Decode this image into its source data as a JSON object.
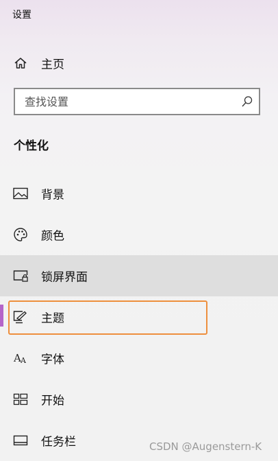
{
  "window": {
    "title": "设置"
  },
  "home": {
    "label": "主页",
    "icon": "home-icon"
  },
  "search": {
    "placeholder": "查找设置",
    "icon": "search-icon"
  },
  "section": {
    "heading": "个性化"
  },
  "nav_items": [
    {
      "label": "背景",
      "icon": "picture-icon"
    },
    {
      "label": "颜色",
      "icon": "palette-icon"
    },
    {
      "label": "锁屏界面",
      "icon": "lock-screen-icon",
      "state": "hover"
    },
    {
      "label": "主题",
      "icon": "theme-brush-icon",
      "state": "selected"
    },
    {
      "label": "字体",
      "icon": "font-icon"
    },
    {
      "label": "开始",
      "icon": "start-menu-icon"
    },
    {
      "label": "任务栏",
      "icon": "taskbar-icon"
    }
  ],
  "colors": {
    "accent": "#b565c9",
    "annotation": "#ee8f3d",
    "hover": "#dedede"
  },
  "watermark": {
    "text": "CSDN @Augenstern-K"
  }
}
